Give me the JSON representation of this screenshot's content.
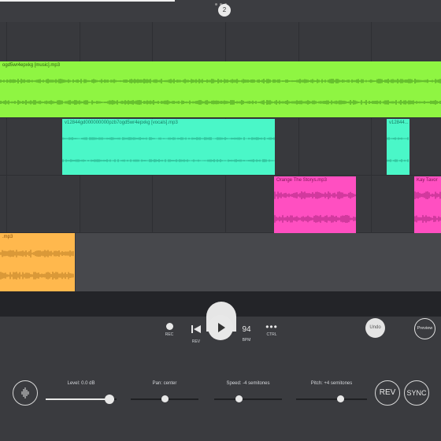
{
  "header": {
    "knob_label": "2"
  },
  "clips": {
    "green": {
      "name": "ogd5wr4epxkg [music].mp3",
      "color": "#8ff542"
    },
    "teal1": {
      "name": "v12844gd000000000pzb7ogd5wr4epxkg [vocals].mp3",
      "color": "#4af7c8"
    },
    "teal2": {
      "name": "v12844...",
      "color": "#4af7c8"
    },
    "pink1": {
      "name": "Orange The Storys.mp3",
      "color": "#ff4fc1"
    },
    "pink2": {
      "name": "Kay Tavor",
      "color": "#ff4fc1"
    },
    "orange": {
      "name": ".mp3",
      "color": "#ffb84d"
    }
  },
  "transport": {
    "rec_label": "REC",
    "rev_label": "REV",
    "bpm_value": "94",
    "bpm_label": "BPM",
    "ctrl_label": "CTRL",
    "undo_label": "Undo",
    "preview_label": "Preview"
  },
  "mixer": {
    "level": {
      "label": "Level: 0.0 dB",
      "fraction": 0.9
    },
    "pan": {
      "label": "Pan: center",
      "fraction": 0.5
    },
    "speed": {
      "label": "Speed: -4 semitones",
      "fraction": 0.37
    },
    "pitch": {
      "label": "Pitch: +4 semitones",
      "fraction": 0.63
    },
    "rev_button": "REV",
    "sync_button": "SYNC"
  }
}
